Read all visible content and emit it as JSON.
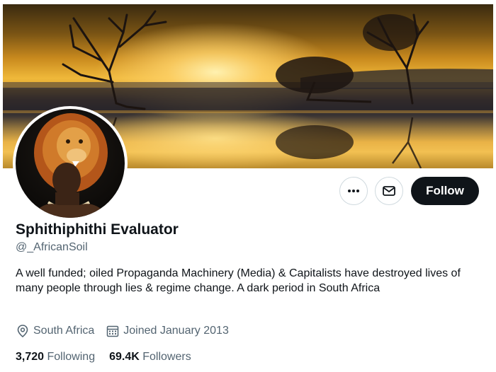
{
  "profile": {
    "display_name": "Sphithiphithi Evaluator",
    "handle": "@_AfricanSoil",
    "bio": "A well funded; oiled Propaganda Machinery (Media) & Capitalists have destroyed lives of many people through lies & regime change. A dark period in South Africa",
    "location": "South Africa",
    "joined": "Joined January 2013",
    "following_count": "3,720",
    "following_label": "Following",
    "followers_count": "69.4K",
    "followers_label": "Followers"
  },
  "actions": {
    "follow_label": "Follow",
    "more_icon": "more-icon",
    "message_icon": "envelope-icon"
  },
  "banner": {
    "description_icon": "sunset-trees-banner"
  },
  "colors": {
    "follow_button_bg": "#0f1419",
    "secondary_text": "#536471",
    "border": "#cfd9de"
  }
}
